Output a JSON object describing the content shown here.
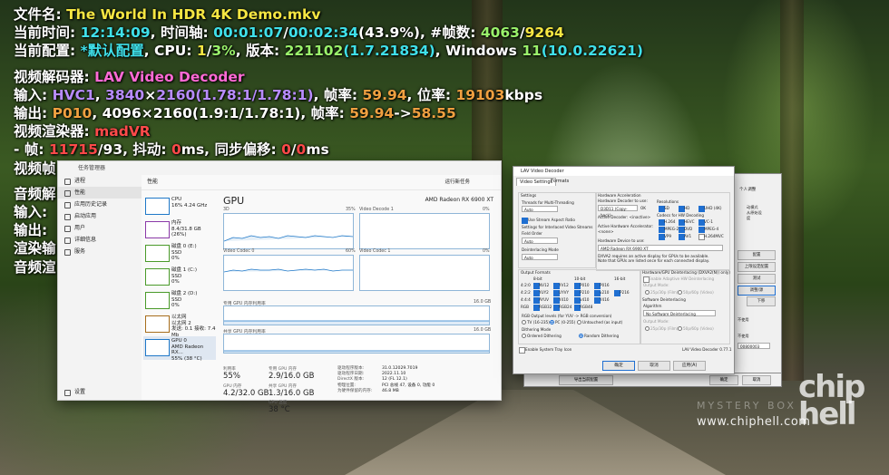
{
  "osd": {
    "l1": {
      "k": "文件名: ",
      "file": "The World In HDR 4K Demo.mkv"
    },
    "l2": {
      "k": "当前时间: ",
      "time": "12:14:09",
      "k2": ", 时间轴: ",
      "pos": "00:01:07",
      "sep": "/",
      "dur": "00:02:34",
      "pct": "(43.9%)",
      "k3": ", #帧数: ",
      "frame": "4063",
      "sep2": "/",
      "frames": "9264"
    },
    "l3": {
      "k": "当前配置: ",
      "cfg": "*默认配置",
      "k2": ", CPU: ",
      "cpu1": "1",
      "sep": "/",
      "cpu2": "3%",
      "k3": ", 版本: ",
      "ver": "221102",
      "ver2": "(1.7.21834)",
      "k4": ", Windows ",
      "win": "11",
      "winb": "(10.0.22621)"
    },
    "l4": {
      "k": "视频解码器: ",
      "dec": "LAV Video Decoder"
    },
    "l5": {
      "k": "输入: ",
      "codec": "HVC1",
      "c1": ", ",
      "res": "3840",
      "x": "×",
      "res2": "2160",
      "ar": "(1.78:1/1.78:1)",
      "k2": ", 帧率: ",
      "fps": "59.94",
      "k3": ", 位率: ",
      "br": "19103",
      "unit": "kbps"
    },
    "l6": {
      "k": "输出: ",
      "fmt": "P010",
      "rest": ", 4096×2160(1.9:1/1.78:1), 帧率: ",
      "fps": "59.94",
      "arrow": "->",
      "fps2": "58.55"
    },
    "l7": {
      "k": "视频渲染器: ",
      "ren": "madVR"
    },
    "l8": {
      "k": " - 帧: ",
      "fr": "11715",
      "sep": "/93, 抖动: ",
      "jit": "0",
      "ms": "ms, 同步偏移: ",
      "sync": "0",
      "sep2": "/",
      "sync2": "0",
      "ms2": "ms"
    },
    "l9": "视频帧",
    "l10": "音频解",
    "l11": "输入: ",
    "l12": "输出: ",
    "l13": "渲染输",
    "l14": "音频渲"
  },
  "taskmgr": {
    "title": "任务管理器",
    "header": "性能",
    "run_task": "运行新任务",
    "nav": [
      "进程",
      "性能",
      "应用历史记录",
      "启动应用",
      "用户",
      "详细信息",
      "服务"
    ],
    "settings": "设置",
    "list": [
      {
        "name": "CPU",
        "sub": "16% 4.24 GHz",
        "color": "#1f78c8"
      },
      {
        "name": "内存",
        "sub": "8.4/31.8 GB (26%)",
        "color": "#8b3aa8"
      },
      {
        "name": "磁盘 0 (E:)",
        "sub": "SSD",
        "sub2": "0%",
        "color": "#4a9a2a"
      },
      {
        "name": "磁盘 1 (C:)",
        "sub": "SSD",
        "sub2": "0%",
        "color": "#4a9a2a"
      },
      {
        "name": "磁盘 2 (D:)",
        "sub": "SSD",
        "sub2": "0%",
        "color": "#4a9a2a"
      },
      {
        "name": "以太网",
        "sub": "以太网 2",
        "sub2": "发送: 0.1 接收: 7.4 Mb",
        "color": "#a76d1c"
      },
      {
        "name": "GPU 0",
        "sub": "AMD Radeon RX...",
        "sub2": "55% (38 °C)",
        "color": "#1f78c8"
      }
    ],
    "gpu_title": "GPU",
    "gpu_name": "AMD Radeon RX 6900 XT",
    "graphs": [
      {
        "label": "3D",
        "pct": "35%",
        "right_label": "Video Decode 1",
        "right_pct": "0%"
      },
      {
        "label": "Video Codec 0",
        "pct": "60%",
        "right_label": "Video Codec 1",
        "right_pct": "0%"
      }
    ],
    "dedicated_label": "专用 GPU 内存利用率",
    "dedicated_max": "16.0 GB",
    "shared_label": "共享 GPU 内存利用率",
    "shared_max": "16.0 GB",
    "stats": {
      "util_label": "利用率",
      "util": "55%",
      "ded_label": "专用 GPU 内存",
      "ded": "2.9/16.0 GB",
      "gmem_label": "GPU 内存",
      "gmem": "4.2/32.0 GB",
      "shared_label": "共享 GPU 内存",
      "shared": "1.3/16.0 GB",
      "temp_label": "GPU 温度",
      "temp": "38 °C"
    },
    "kv": [
      [
        "驱动程序版本:",
        "31.0.12029.7019"
      ],
      [
        "驱动程序日期:",
        "2022.11.10"
      ],
      [
        "DirectX 版本:",
        "12 (FL 12.1)"
      ],
      [
        "物理位置:",
        "PCI 总线 47, 设备 0, 功能 0"
      ],
      [
        "为硬件保留的内存:",
        "46.8 MB"
      ]
    ]
  },
  "lav": {
    "title": "LAV Video Decoder",
    "tabs": [
      "Video Settings",
      "Formats"
    ],
    "settings": "Settings",
    "threads_label": "Threads for Multi-Threading",
    "threads_val": "Auto",
    "aspect": "Use Stream Aspect Ratio",
    "interlaced_label": "Settings for Interlaced Video Streams",
    "field_order": "Field Order",
    "field_val": "Auto",
    "deint_mode": "Deinterlacing Mode",
    "deint_val": "Auto",
    "hwa": "Hardware Acceleration",
    "hwdec_label": "Hardware Decoder to use:",
    "hwdec_val": "D3D11 (Copy-back)",
    "ok": "OK",
    "active_dec": "Active Decoder: <inactive>",
    "active_acc": "Active Hardware Accelerator:",
    "active_none": "<none>",
    "hwdev_label": "Hardware Device to use:",
    "hwdev_val": "AMD Radeon RX 6900 XT",
    "dx_note1": "DXVA2 requires an active display for GPUs to be available.",
    "dx_note2": "Note that GPUs are listed once for each connected display.",
    "resolutions": "Resolutions",
    "res_items": [
      "SD",
      "HD",
      "UHD (4K)"
    ],
    "codecs_label": "Codecs for HW Decoding",
    "codec_items": [
      "H.264",
      "HEVC",
      "VC-1",
      "MPEG-2",
      "DVD",
      "MPEG-4",
      "VP9",
      "AV1",
      "H.264MVC"
    ],
    "hwdeint": "Hardware/GPU Deinterlacing (DXVA2(N)) only)",
    "adaptive": "Enable Adaptive HW Deinterlacing",
    "output_mode": "Output Mode:",
    "p25": "25p/30p (Film)",
    "p50": "50p/60p (Video)",
    "sw_deint": "Software Deinterlacing",
    "algorithm": "Algorithm",
    "algo_val": "No Software Deinterlacing",
    "output_mode2": "Output Mode:",
    "output_formats": "Output Formats",
    "bit8": "8-bit",
    "bit10": "10-bit",
    "bit16": "16-bit",
    "fmt_rows": [
      [
        "4:2:0",
        "NV12",
        "YV12",
        "P010",
        "P016"
      ],
      [
        "4:2:2",
        "YUY2",
        "UYVY",
        "P210",
        "v210",
        "P216"
      ],
      [
        "4:4:4",
        "AYUV",
        "Y410",
        "v410",
        "Y416"
      ],
      [
        "RGB",
        "RGB32",
        "RGB24",
        "RGB48"
      ]
    ],
    "rgb_label": "RGB Output levels (for YUV -> RGB conversion)",
    "rgb_opts": [
      "TV (16-235)",
      "PC (0-255)",
      "Untouched (as input)"
    ],
    "dither_label": "Dithering Mode",
    "dither_opts": [
      "Ordered Dithering",
      "Random Dithering"
    ],
    "tray": "Enable System Tray Icon",
    "version": "LAV Video Decoder 0.77.1",
    "buttons": [
      "确定",
      "取消",
      "应用(A)"
    ]
  },
  "madvr": {
    "mode": "个人调整",
    "lines": [
      "动模式",
      "从原始设",
      "度"
    ],
    "btns": [
      "配置",
      "上限设定配置",
      "测试",
      "调整/源"
    ],
    "down": "下移",
    "notuse": "不使用",
    "notuse2": "不使用",
    "code": "00800003",
    "export": "导出当前配置",
    "ok": "确定",
    "cancel": "取消"
  },
  "watermark": {
    "site": "www.chiphell.com",
    "brand": "MYSTERY BOX",
    "logo": "chip hell"
  }
}
